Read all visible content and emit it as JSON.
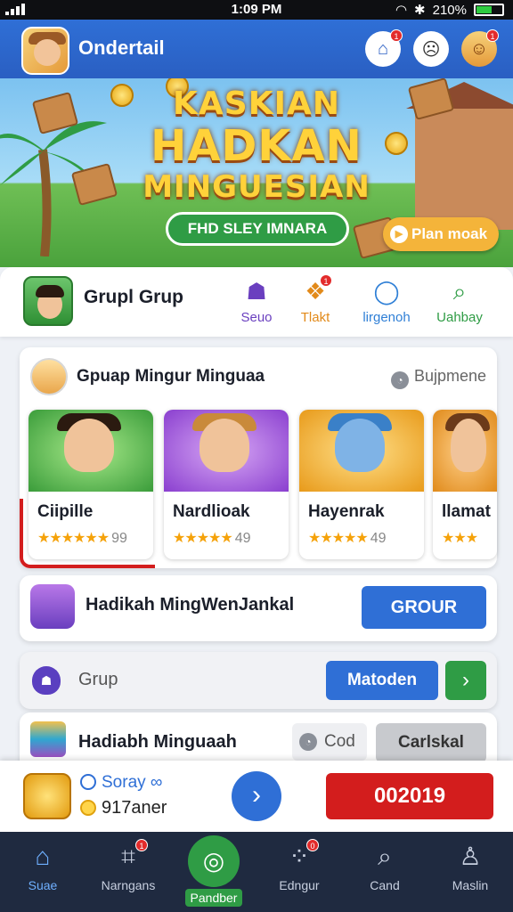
{
  "status_bar": {
    "time": "1:09 PM",
    "battery": "210%"
  },
  "header": {
    "app_title": "Ondertail",
    "notif_badge": "1",
    "avatar_badge": "1"
  },
  "banner": {
    "title_line1": "KASKIAN",
    "title_line2": "HADKAN",
    "title_line3": "MINGUESIAN",
    "pill_text": "FHD SLEY IMNARA",
    "cta_label": "Plan moak"
  },
  "group_bar": {
    "title": "Grupl Grup",
    "tabs": [
      {
        "label": "Seuo",
        "icon": "ghost-icon",
        "color": "#6a3fbf"
      },
      {
        "label": "Tlakt",
        "icon": "gift-icon",
        "color": "#e28a1a"
      },
      {
        "label": "lirgenoh",
        "icon": "chat-icon",
        "color": "#2f7fd6"
      },
      {
        "label": "Uahbay",
        "icon": "search-icon",
        "color": "#2f9c45"
      }
    ],
    "tab_badge": "1"
  },
  "section": {
    "title": "Gpuap Mingur Minguaa",
    "action": "Bujpmene",
    "games": [
      {
        "name": "Ciipille",
        "stars": "★★★★★★",
        "rating": "99",
        "bg": "#5cc25c",
        "hat": "#2b1a10"
      },
      {
        "name": "Nardlioak",
        "stars": "★★★★★",
        "rating": "49",
        "bg": "#b069e0",
        "hat": "#c98a3a"
      },
      {
        "name": "Hayenrak",
        "stars": "★★★★★",
        "rating": "49",
        "bg": "#f4b43a",
        "hat": "#3a80c8"
      },
      {
        "name": "llamat",
        "stars": "★★★",
        "rating": "",
        "bg": "#f2a03a",
        "hat": "#6b3a1a"
      }
    ]
  },
  "reward_row": {
    "title": "Hadikah MingWenJankal",
    "button": "GROUR"
  },
  "group_row": {
    "label": "Grup",
    "button": "Matoden",
    "arrow": "›"
  },
  "daily_row": {
    "title": "Hadiabh Minguaah",
    "cod_label": "Cod",
    "grey_button": "Carlskal"
  },
  "reward_strip": {
    "line1": "Soray",
    "line2": "917aner",
    "code": "002019",
    "next": "›"
  },
  "bottom_nav": [
    {
      "label": "Suae",
      "icon": "home-icon",
      "badge": ""
    },
    {
      "label": "Narngans",
      "icon": "chart-icon",
      "badge": "1"
    },
    {
      "label": "Pandber",
      "icon": "compass-icon",
      "badge": ""
    },
    {
      "label": "Edngur",
      "icon": "grid-icon",
      "badge": "0"
    },
    {
      "label": "Cand",
      "icon": "search-icon",
      "badge": ""
    },
    {
      "label": "Maslin",
      "icon": "user-icon",
      "badge": ""
    }
  ],
  "colors": {
    "primary": "#2f6fd6",
    "green": "#2f9c45",
    "red": "#d31d1d",
    "nav_bg": "#1f2a40"
  }
}
